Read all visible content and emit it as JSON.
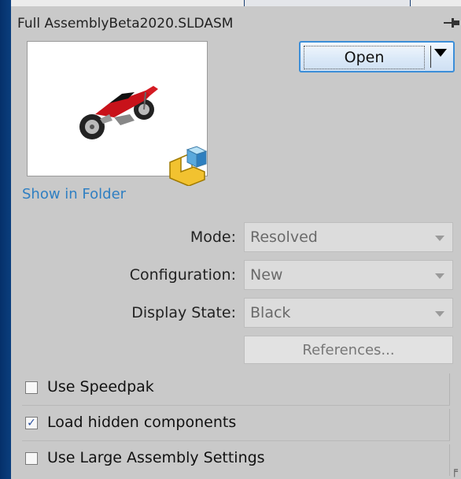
{
  "dialog": {
    "filename": "Full AssemblyBeta2020.SLDASM",
    "open_label": "Open",
    "show_in_folder": "Show in Folder"
  },
  "fields": {
    "mode_label": "Mode:",
    "mode_value": "Resolved",
    "configuration_label": "Configuration:",
    "configuration_value": "New",
    "display_state_label": "Display State:",
    "display_state_value": "Black",
    "references_label": "References..."
  },
  "options": [
    {
      "label": "Use Speedpak",
      "checked": false
    },
    {
      "label": "Load hidden components",
      "checked": true
    },
    {
      "label": "Use Large Assembly Settings",
      "checked": false
    }
  ],
  "icons": {
    "pin": "pin-icon",
    "assembly": "assembly-icon",
    "thumbnail": "motorcycle-thumbnail"
  },
  "colors": {
    "panel_bg": "#c9c9c9",
    "link": "#2f7fc2",
    "button_border": "#3b8ed8",
    "window_frame": "#0a3a72"
  }
}
